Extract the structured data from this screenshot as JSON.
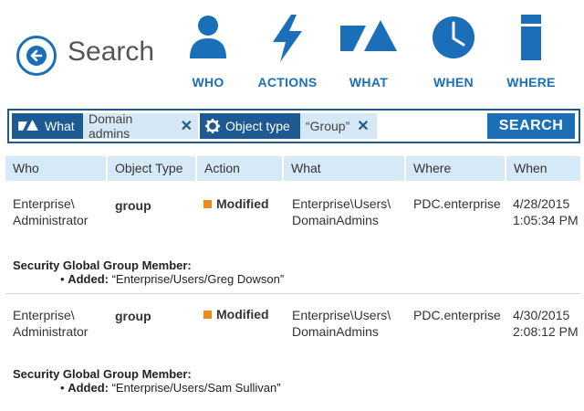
{
  "header": {
    "title": "Search",
    "nav": [
      {
        "id": "who",
        "label": "WHO",
        "icon": "person-icon"
      },
      {
        "id": "actions",
        "label": "ACTIONS",
        "icon": "lightning-icon"
      },
      {
        "id": "what",
        "label": "WHAT",
        "icon": "shapes-icon"
      },
      {
        "id": "when",
        "label": "WHEN",
        "icon": "clock-icon"
      },
      {
        "id": "where",
        "label": "WHERE",
        "icon": "server-icon"
      }
    ]
  },
  "filters": {
    "chip1": {
      "label": "What",
      "value": "Domain admins",
      "remove": "✕"
    },
    "chip2": {
      "label": "Object type",
      "value": "“Group”",
      "remove": "✕"
    },
    "search_label": "SEARCH"
  },
  "table": {
    "columns": [
      "Who",
      "Object Type",
      "Action",
      "What",
      "Where",
      "When"
    ],
    "rows": [
      {
        "who_line1": "Enterprise\\",
        "who_line2": "Administrator",
        "object_type": "group",
        "action": "Modified",
        "what_line1": "Enterprise\\Users\\",
        "what_line2": "DomainAdmins",
        "where": "PDC.enterprise",
        "when_date": "4/28/2015",
        "when_time": "1:05:34 PM",
        "detail_heading": "Security Global Group Member:",
        "detail_bullet": "•",
        "detail_key": "Added:",
        "detail_value": "“Enterprise/Users/Greg Dowson”"
      },
      {
        "who_line1": "Enterprise\\",
        "who_line2": "Administrator",
        "object_type": "group",
        "action": "Modified",
        "what_line1": "Enterprise\\Users\\",
        "what_line2": "DomainAdmins",
        "where": "PDC.enterprise",
        "when_date": "4/30/2015",
        "when_time": "2:08:12 PM",
        "detail_heading": "Security Global Group Member:",
        "detail_bullet": "•",
        "detail_key": "Added:",
        "detail_value": "“Enterprise/Users/Sam Sullivan”"
      }
    ]
  },
  "colors": {
    "accent": "#1a6fb8",
    "chip_dark": "#1d5a92",
    "chip_light": "#d6e7f5",
    "header_row": "#d6e9f7",
    "modified": "#f08a1e"
  }
}
